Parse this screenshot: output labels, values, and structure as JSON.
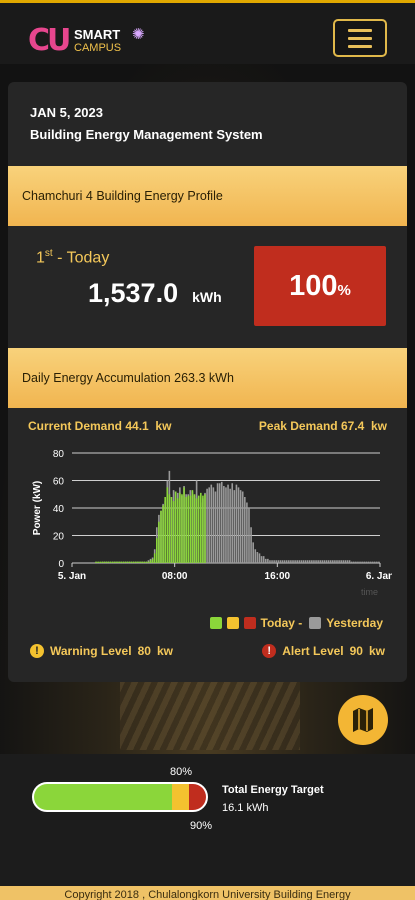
{
  "header": {
    "logo_cu": "CU",
    "logo_smart": "SMART",
    "logo_campus": "CAMPUS",
    "menu_icon": "hamburger-menu-icon"
  },
  "card": {
    "date": "JAN 5, 2023",
    "system_title": "Building Energy Management System",
    "profile_title": "Chamchuri 4 Building Energy Profile",
    "today_rank": "1",
    "today_rank_suffix": "st",
    "today_label": " - Today",
    "energy_value": "1,537.0",
    "energy_unit": "kWh",
    "percent_value": "100",
    "percent_sign": "%",
    "accumulation": "Daily Energy Accumulation 263.3 kWh",
    "current_demand_label": "Current  Demand",
    "current_demand_value": "44.1",
    "current_demand_unit": "kw",
    "peak_demand_label": "Peak Demand",
    "peak_demand_value": "67.4",
    "peak_demand_unit": "kw",
    "legend_today": "Today -",
    "legend_yesterday": "Yesterday",
    "warning_label": "Warning Level",
    "warning_value": "80",
    "warning_unit": "kw",
    "alert_label": "Alert Level",
    "alert_value": "90",
    "alert_unit": "kw",
    "colors": {
      "green": "#8bd63a",
      "yellow": "#f4c22f",
      "red": "#c02d1e",
      "grey": "#9a9a9a"
    }
  },
  "chart_data": {
    "type": "bar",
    "ylabel": "Power (kW)",
    "xlabel": "time",
    "ylim": [
      0,
      80
    ],
    "yticks": [
      0,
      20,
      40,
      60,
      80
    ],
    "xtick_labels": [
      "5. Jan",
      "08:00",
      "16:00",
      "6. Jan"
    ],
    "xrange_hours": [
      0,
      24
    ],
    "series": [
      {
        "name": "Yesterday",
        "color": "#9a9a9a",
        "values": [
          0,
          0,
          0,
          0,
          0,
          0,
          0,
          0,
          0,
          0,
          0,
          0,
          0,
          0,
          1,
          1,
          1,
          1,
          1,
          1,
          1,
          1,
          1,
          1,
          1,
          1,
          1,
          1,
          1,
          1,
          1,
          1,
          1,
          1,
          1,
          1,
          2,
          3,
          4,
          10,
          26,
          35,
          38,
          43,
          45,
          60,
          67,
          40,
          53,
          52,
          51,
          55,
          49,
          56,
          50,
          50,
          53,
          52,
          49,
          60,
          48,
          44,
          47,
          51,
          54,
          55,
          57,
          55,
          52,
          58,
          58,
          59,
          56,
          55,
          57,
          54,
          58,
          53,
          57,
          55,
          53,
          52,
          48,
          44,
          40,
          26,
          15,
          10,
          8,
          7,
          5,
          5,
          3,
          3,
          2,
          2,
          2,
          2,
          2,
          2,
          2,
          2,
          2,
          2,
          2,
          2,
          2,
          2,
          2,
          2,
          2,
          2,
          2,
          2,
          2,
          2,
          2,
          2,
          2,
          2,
          2,
          2,
          2,
          2,
          2,
          2,
          2,
          2,
          2,
          2,
          2,
          2,
          2,
          1,
          1,
          1,
          1,
          1,
          1,
          1,
          1,
          1,
          1,
          1,
          1,
          1,
          1
        ]
      },
      {
        "name": "Today",
        "color": "#8bd63a",
        "values": [
          0,
          0,
          0,
          0,
          0,
          0,
          0,
          0,
          0,
          0,
          0,
          1,
          1,
          1,
          1,
          1,
          1,
          1,
          1,
          1,
          1,
          1,
          1,
          1,
          1,
          1,
          1,
          1,
          1,
          1,
          1,
          1,
          1,
          1,
          1,
          1,
          1,
          2,
          3,
          7,
          18,
          30,
          38,
          42,
          48,
          55,
          50,
          48,
          45,
          52,
          47,
          51,
          50,
          55,
          48,
          49,
          49,
          53,
          50,
          47,
          49,
          51,
          49,
          50
        ]
      }
    ]
  },
  "bottom": {
    "mark_80": "80%",
    "mark_90": "90%",
    "target_title": "Total Energy Target",
    "target_value": "16.1 kWh",
    "green_fraction": 0.8,
    "yellow_fraction": 0.1,
    "red_fraction": 0.1
  },
  "footer": {
    "copyright": "Copyright 2018 , Chulalongkorn University Building Energy"
  }
}
